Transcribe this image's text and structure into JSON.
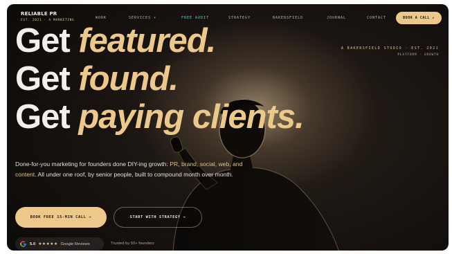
{
  "brand": {
    "name": "RELIABLE PR",
    "tagline": "EST. 2021 · A MARKETING"
  },
  "nav": {
    "items": [
      {
        "label": "WORK",
        "active": false
      },
      {
        "label": "SERVICES ▾",
        "active": false
      },
      {
        "label": "FREE AUDIT",
        "active": true
      },
      {
        "label": "STRATEGY",
        "active": false
      },
      {
        "label": "BAKERSFIELD",
        "active": false
      },
      {
        "label": "JOURNAL",
        "active": false
      },
      {
        "label": "CONTACT",
        "active": false
      }
    ],
    "cta_label": "BOOK A CALL ↗"
  },
  "meta": {
    "line1": "A BAKERSFIELD STUDIO · EST. 2021",
    "line2": "PLATFORM · GROWTH"
  },
  "hero": {
    "line1_white": "Get",
    "line1_gold": "featured.",
    "line2_white": "Get",
    "line2_gold": "found.",
    "line3_white": "Get",
    "line3_gold": "paying clients.",
    "body_part1": "Done-for-you marketing for founders done DIY-ing growth:",
    "body_highlight": "PR, brand, social, web, and content.",
    "body_part2": "All under one roof, by senior people, built to compound month over month."
  },
  "buttons": {
    "primary_label": "BOOK FREE 15-MIN CALL →",
    "secondary_label": "START WITH STRATEGY →"
  },
  "trust": {
    "rating": "5.0",
    "stars": "★★★★★",
    "source": "Google Reviews",
    "trusted_text": "Trusted by 50+ founders"
  },
  "colors": {
    "accent_gold": "#ecc88a",
    "active_nav": "#78c9cf",
    "background": "#0b0907"
  }
}
